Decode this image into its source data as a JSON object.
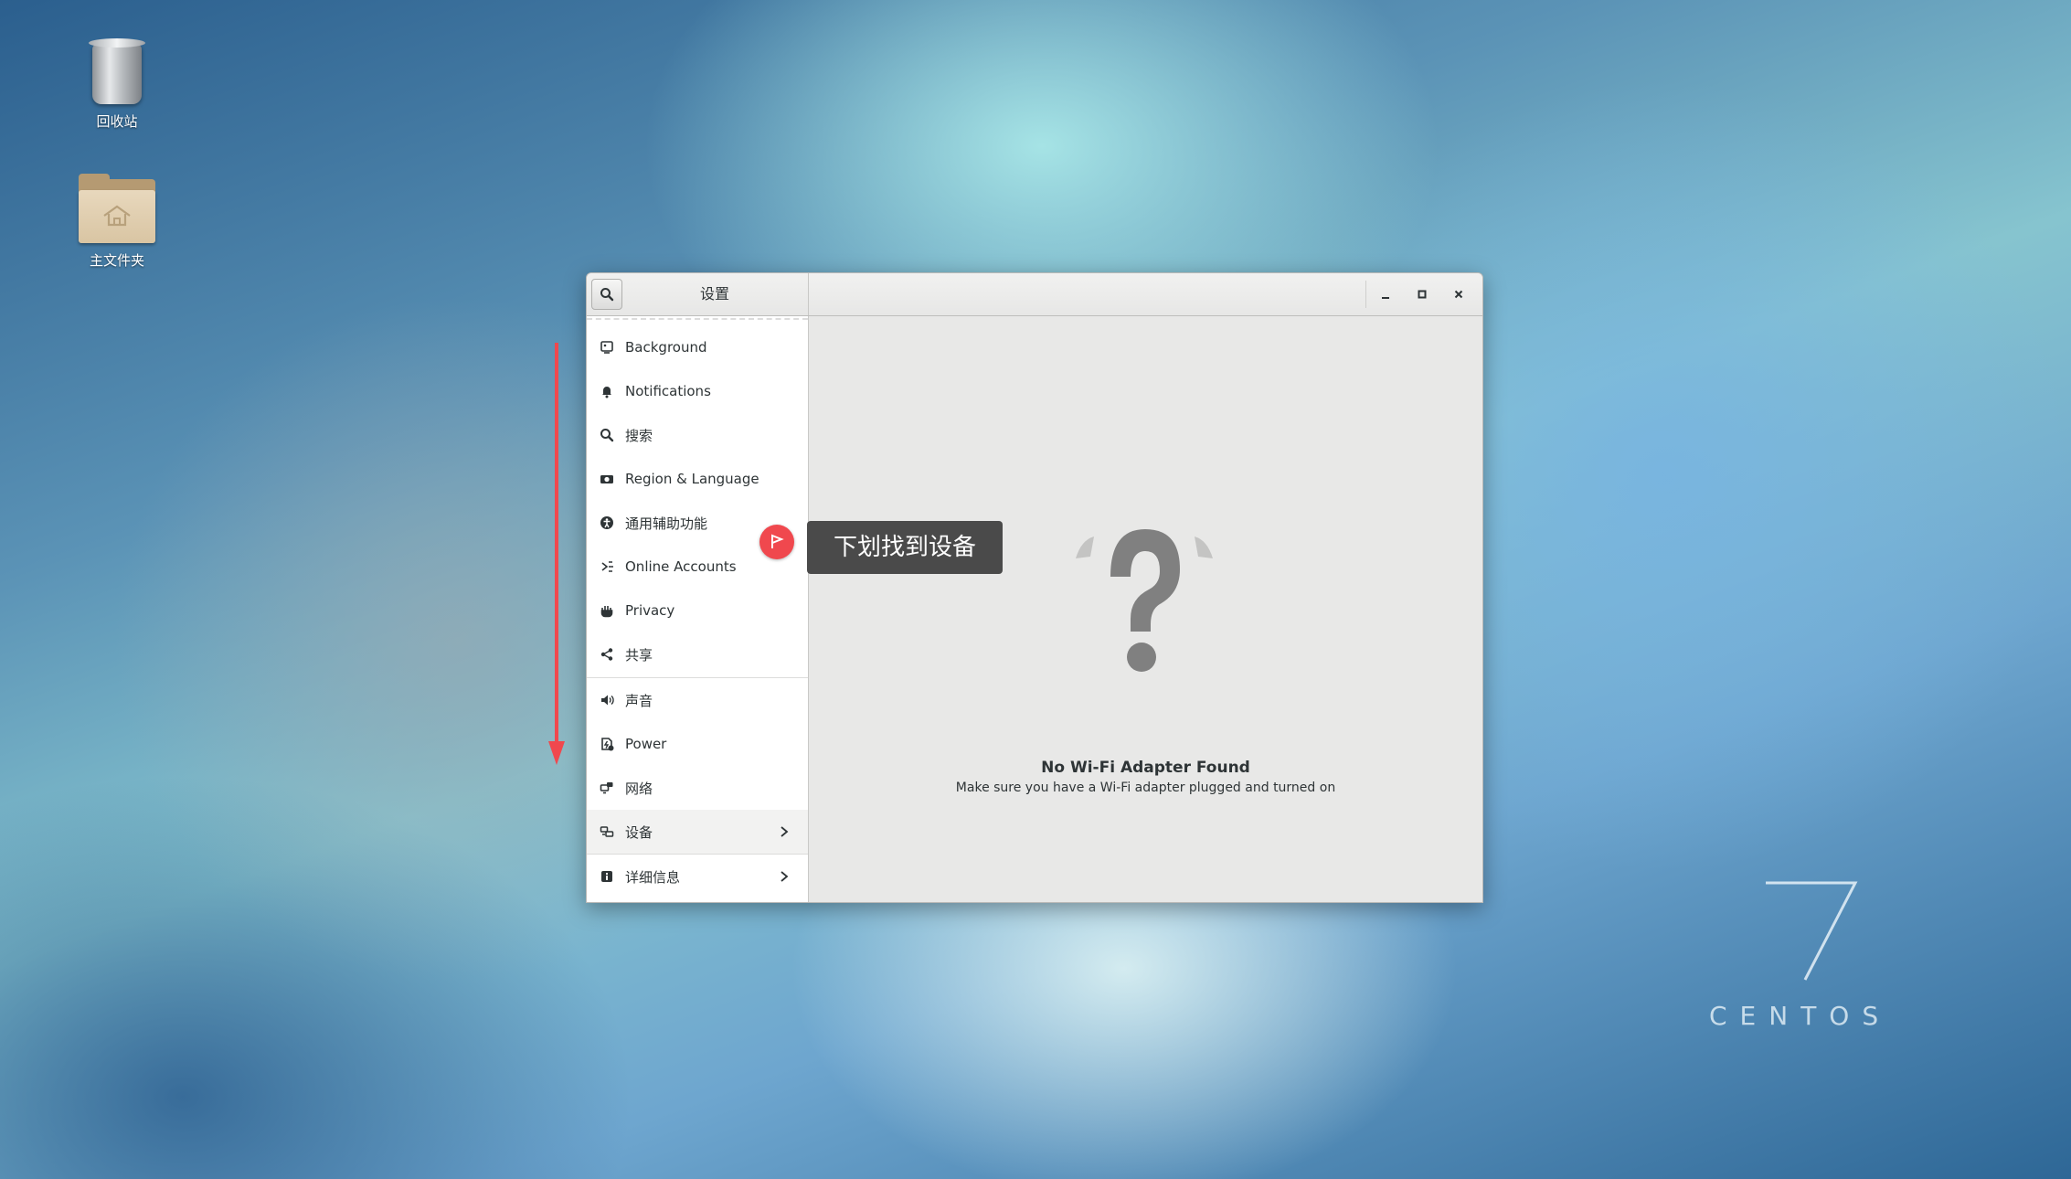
{
  "desktop": {
    "icons": [
      {
        "label": "回收站",
        "icon": "trash-icon"
      },
      {
        "label": "主文件夹",
        "icon": "home-folder-icon"
      }
    ],
    "watermark": {
      "number": "7",
      "word": "CENTOS"
    }
  },
  "window": {
    "title": "设置",
    "search_icon": "search-icon",
    "controls": {
      "minimize": "minimize-icon",
      "maximize": "maximize-icon",
      "close": "close-icon"
    }
  },
  "sidebar": {
    "items": [
      {
        "label": "Background",
        "icon": "background-icon"
      },
      {
        "label": "Notifications",
        "icon": "bell-icon"
      },
      {
        "label": "搜索",
        "icon": "search-icon"
      },
      {
        "label": "Region & Language",
        "icon": "region-icon"
      },
      {
        "label": "通用辅助功能",
        "icon": "accessibility-icon"
      },
      {
        "label": "Online Accounts",
        "icon": "online-accounts-icon"
      },
      {
        "label": "Privacy",
        "icon": "hand-icon"
      },
      {
        "label": "共享",
        "icon": "share-icon"
      },
      {
        "label": "声音",
        "icon": "speaker-icon"
      },
      {
        "label": "Power",
        "icon": "power-icon"
      },
      {
        "label": "网络",
        "icon": "network-icon"
      },
      {
        "label": "设备",
        "icon": "devices-icon",
        "selected": true
      },
      {
        "label": "详细信息",
        "icon": "info-icon"
      }
    ]
  },
  "content": {
    "empty_icon": "question-mark-icon",
    "title": "No Wi-Fi Adapter Found",
    "subtitle": "Make sure you have a Wi-Fi adapter plugged and turned on"
  },
  "annotation": {
    "tooltip": "下划找到设备",
    "colors": {
      "arrow": "#f0484e",
      "pin": "#f0484e",
      "tooltip_bg": "#4a4a4a"
    }
  }
}
